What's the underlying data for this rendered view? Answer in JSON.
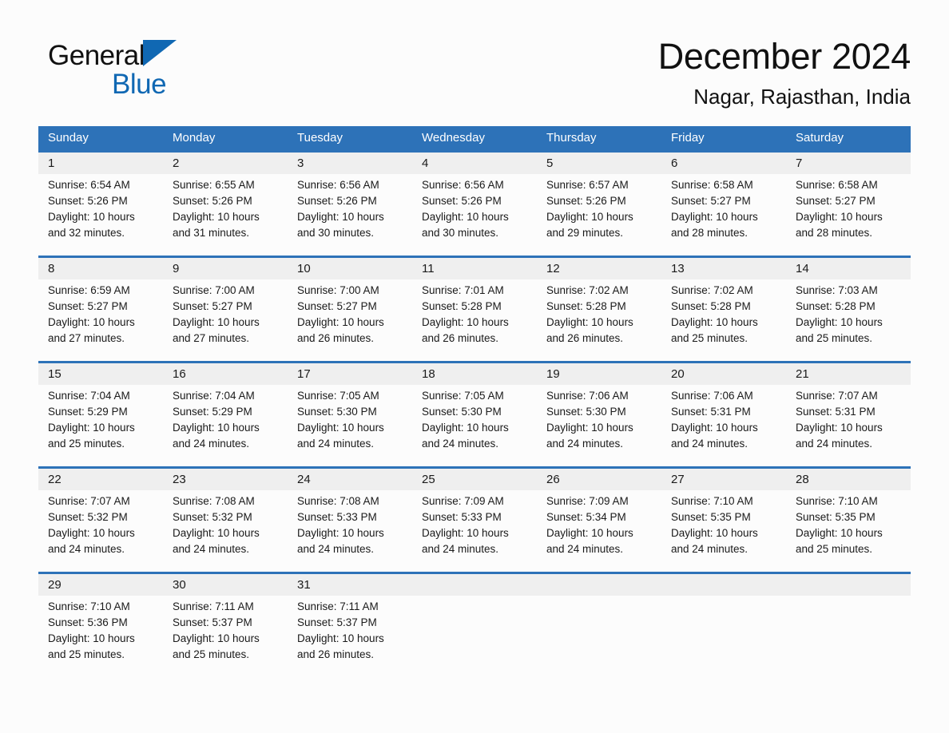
{
  "brand": {
    "name_part1": "General",
    "name_part2": "Blue",
    "triangle_color": "#1068b3",
    "icon": "triangle-right-icon"
  },
  "header": {
    "title": "December 2024",
    "subtitle": "Nagar, Rajasthan, India"
  },
  "colors": {
    "header_blue": "#2d72b8",
    "daynum_band": "#efefef",
    "page_background": "#fcfcfc",
    "text": "#1a1a1a"
  },
  "calendar": {
    "weekdays": [
      "Sunday",
      "Monday",
      "Tuesday",
      "Wednesday",
      "Thursday",
      "Friday",
      "Saturday"
    ],
    "weeks": [
      [
        {
          "day": "1",
          "sunrise": "Sunrise: 6:54 AM",
          "sunset": "Sunset: 5:26 PM",
          "daylight": "Daylight: 10 hours and 32 minutes."
        },
        {
          "day": "2",
          "sunrise": "Sunrise: 6:55 AM",
          "sunset": "Sunset: 5:26 PM",
          "daylight": "Daylight: 10 hours and 31 minutes."
        },
        {
          "day": "3",
          "sunrise": "Sunrise: 6:56 AM",
          "sunset": "Sunset: 5:26 PM",
          "daylight": "Daylight: 10 hours and 30 minutes."
        },
        {
          "day": "4",
          "sunrise": "Sunrise: 6:56 AM",
          "sunset": "Sunset: 5:26 PM",
          "daylight": "Daylight: 10 hours and 30 minutes."
        },
        {
          "day": "5",
          "sunrise": "Sunrise: 6:57 AM",
          "sunset": "Sunset: 5:26 PM",
          "daylight": "Daylight: 10 hours and 29 minutes."
        },
        {
          "day": "6",
          "sunrise": "Sunrise: 6:58 AM",
          "sunset": "Sunset: 5:27 PM",
          "daylight": "Daylight: 10 hours and 28 minutes."
        },
        {
          "day": "7",
          "sunrise": "Sunrise: 6:58 AM",
          "sunset": "Sunset: 5:27 PM",
          "daylight": "Daylight: 10 hours and 28 minutes."
        }
      ],
      [
        {
          "day": "8",
          "sunrise": "Sunrise: 6:59 AM",
          "sunset": "Sunset: 5:27 PM",
          "daylight": "Daylight: 10 hours and 27 minutes."
        },
        {
          "day": "9",
          "sunrise": "Sunrise: 7:00 AM",
          "sunset": "Sunset: 5:27 PM",
          "daylight": "Daylight: 10 hours and 27 minutes."
        },
        {
          "day": "10",
          "sunrise": "Sunrise: 7:00 AM",
          "sunset": "Sunset: 5:27 PM",
          "daylight": "Daylight: 10 hours and 26 minutes."
        },
        {
          "day": "11",
          "sunrise": "Sunrise: 7:01 AM",
          "sunset": "Sunset: 5:28 PM",
          "daylight": "Daylight: 10 hours and 26 minutes."
        },
        {
          "day": "12",
          "sunrise": "Sunrise: 7:02 AM",
          "sunset": "Sunset: 5:28 PM",
          "daylight": "Daylight: 10 hours and 26 minutes."
        },
        {
          "day": "13",
          "sunrise": "Sunrise: 7:02 AM",
          "sunset": "Sunset: 5:28 PM",
          "daylight": "Daylight: 10 hours and 25 minutes."
        },
        {
          "day": "14",
          "sunrise": "Sunrise: 7:03 AM",
          "sunset": "Sunset: 5:28 PM",
          "daylight": "Daylight: 10 hours and 25 minutes."
        }
      ],
      [
        {
          "day": "15",
          "sunrise": "Sunrise: 7:04 AM",
          "sunset": "Sunset: 5:29 PM",
          "daylight": "Daylight: 10 hours and 25 minutes."
        },
        {
          "day": "16",
          "sunrise": "Sunrise: 7:04 AM",
          "sunset": "Sunset: 5:29 PM",
          "daylight": "Daylight: 10 hours and 24 minutes."
        },
        {
          "day": "17",
          "sunrise": "Sunrise: 7:05 AM",
          "sunset": "Sunset: 5:30 PM",
          "daylight": "Daylight: 10 hours and 24 minutes."
        },
        {
          "day": "18",
          "sunrise": "Sunrise: 7:05 AM",
          "sunset": "Sunset: 5:30 PM",
          "daylight": "Daylight: 10 hours and 24 minutes."
        },
        {
          "day": "19",
          "sunrise": "Sunrise: 7:06 AM",
          "sunset": "Sunset: 5:30 PM",
          "daylight": "Daylight: 10 hours and 24 minutes."
        },
        {
          "day": "20",
          "sunrise": "Sunrise: 7:06 AM",
          "sunset": "Sunset: 5:31 PM",
          "daylight": "Daylight: 10 hours and 24 minutes."
        },
        {
          "day": "21",
          "sunrise": "Sunrise: 7:07 AM",
          "sunset": "Sunset: 5:31 PM",
          "daylight": "Daylight: 10 hours and 24 minutes."
        }
      ],
      [
        {
          "day": "22",
          "sunrise": "Sunrise: 7:07 AM",
          "sunset": "Sunset: 5:32 PM",
          "daylight": "Daylight: 10 hours and 24 minutes."
        },
        {
          "day": "23",
          "sunrise": "Sunrise: 7:08 AM",
          "sunset": "Sunset: 5:32 PM",
          "daylight": "Daylight: 10 hours and 24 minutes."
        },
        {
          "day": "24",
          "sunrise": "Sunrise: 7:08 AM",
          "sunset": "Sunset: 5:33 PM",
          "daylight": "Daylight: 10 hours and 24 minutes."
        },
        {
          "day": "25",
          "sunrise": "Sunrise: 7:09 AM",
          "sunset": "Sunset: 5:33 PM",
          "daylight": "Daylight: 10 hours and 24 minutes."
        },
        {
          "day": "26",
          "sunrise": "Sunrise: 7:09 AM",
          "sunset": "Sunset: 5:34 PM",
          "daylight": "Daylight: 10 hours and 24 minutes."
        },
        {
          "day": "27",
          "sunrise": "Sunrise: 7:10 AM",
          "sunset": "Sunset: 5:35 PM",
          "daylight": "Daylight: 10 hours and 24 minutes."
        },
        {
          "day": "28",
          "sunrise": "Sunrise: 7:10 AM",
          "sunset": "Sunset: 5:35 PM",
          "daylight": "Daylight: 10 hours and 25 minutes."
        }
      ],
      [
        {
          "day": "29",
          "sunrise": "Sunrise: 7:10 AM",
          "sunset": "Sunset: 5:36 PM",
          "daylight": "Daylight: 10 hours and 25 minutes."
        },
        {
          "day": "30",
          "sunrise": "Sunrise: 7:11 AM",
          "sunset": "Sunset: 5:37 PM",
          "daylight": "Daylight: 10 hours and 25 minutes."
        },
        {
          "day": "31",
          "sunrise": "Sunrise: 7:11 AM",
          "sunset": "Sunset: 5:37 PM",
          "daylight": "Daylight: 10 hours and 26 minutes."
        },
        {
          "day": "",
          "sunrise": "",
          "sunset": "",
          "daylight": ""
        },
        {
          "day": "",
          "sunrise": "",
          "sunset": "",
          "daylight": ""
        },
        {
          "day": "",
          "sunrise": "",
          "sunset": "",
          "daylight": ""
        },
        {
          "day": "",
          "sunrise": "",
          "sunset": "",
          "daylight": ""
        }
      ]
    ]
  }
}
